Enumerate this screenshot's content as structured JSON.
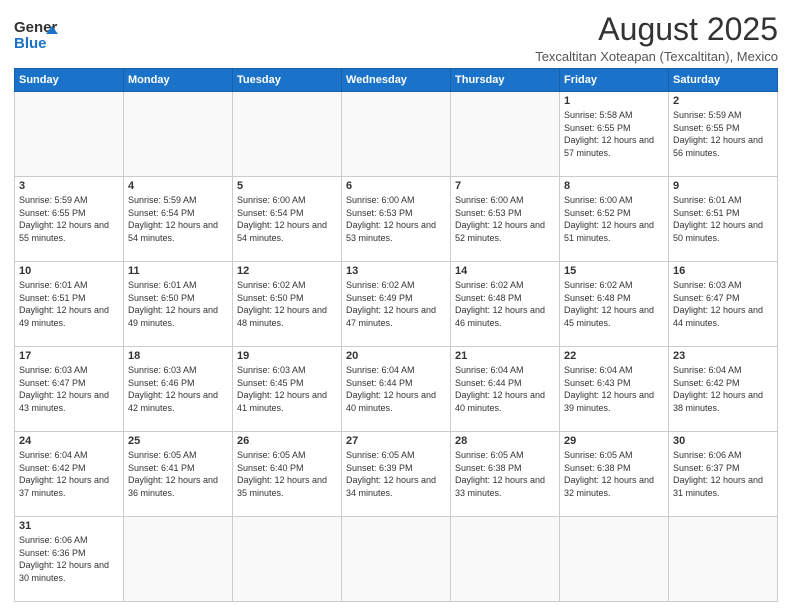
{
  "header": {
    "logo_general": "General",
    "logo_blue": "Blue",
    "main_title": "August 2025",
    "subtitle": "Texcaltitan Xoteapan (Texcaltitan), Mexico"
  },
  "calendar": {
    "weekdays": [
      "Sunday",
      "Monday",
      "Tuesday",
      "Wednesday",
      "Thursday",
      "Friday",
      "Saturday"
    ],
    "weeks": [
      [
        {
          "day": "",
          "info": ""
        },
        {
          "day": "",
          "info": ""
        },
        {
          "day": "",
          "info": ""
        },
        {
          "day": "",
          "info": ""
        },
        {
          "day": "",
          "info": ""
        },
        {
          "day": "1",
          "info": "Sunrise: 5:58 AM\nSunset: 6:55 PM\nDaylight: 12 hours and 57 minutes."
        },
        {
          "day": "2",
          "info": "Sunrise: 5:59 AM\nSunset: 6:55 PM\nDaylight: 12 hours and 56 minutes."
        }
      ],
      [
        {
          "day": "3",
          "info": "Sunrise: 5:59 AM\nSunset: 6:55 PM\nDaylight: 12 hours and 55 minutes."
        },
        {
          "day": "4",
          "info": "Sunrise: 5:59 AM\nSunset: 6:54 PM\nDaylight: 12 hours and 54 minutes."
        },
        {
          "day": "5",
          "info": "Sunrise: 6:00 AM\nSunset: 6:54 PM\nDaylight: 12 hours and 54 minutes."
        },
        {
          "day": "6",
          "info": "Sunrise: 6:00 AM\nSunset: 6:53 PM\nDaylight: 12 hours and 53 minutes."
        },
        {
          "day": "7",
          "info": "Sunrise: 6:00 AM\nSunset: 6:53 PM\nDaylight: 12 hours and 52 minutes."
        },
        {
          "day": "8",
          "info": "Sunrise: 6:00 AM\nSunset: 6:52 PM\nDaylight: 12 hours and 51 minutes."
        },
        {
          "day": "9",
          "info": "Sunrise: 6:01 AM\nSunset: 6:51 PM\nDaylight: 12 hours and 50 minutes."
        }
      ],
      [
        {
          "day": "10",
          "info": "Sunrise: 6:01 AM\nSunset: 6:51 PM\nDaylight: 12 hours and 49 minutes."
        },
        {
          "day": "11",
          "info": "Sunrise: 6:01 AM\nSunset: 6:50 PM\nDaylight: 12 hours and 49 minutes."
        },
        {
          "day": "12",
          "info": "Sunrise: 6:02 AM\nSunset: 6:50 PM\nDaylight: 12 hours and 48 minutes."
        },
        {
          "day": "13",
          "info": "Sunrise: 6:02 AM\nSunset: 6:49 PM\nDaylight: 12 hours and 47 minutes."
        },
        {
          "day": "14",
          "info": "Sunrise: 6:02 AM\nSunset: 6:48 PM\nDaylight: 12 hours and 46 minutes."
        },
        {
          "day": "15",
          "info": "Sunrise: 6:02 AM\nSunset: 6:48 PM\nDaylight: 12 hours and 45 minutes."
        },
        {
          "day": "16",
          "info": "Sunrise: 6:03 AM\nSunset: 6:47 PM\nDaylight: 12 hours and 44 minutes."
        }
      ],
      [
        {
          "day": "17",
          "info": "Sunrise: 6:03 AM\nSunset: 6:47 PM\nDaylight: 12 hours and 43 minutes."
        },
        {
          "day": "18",
          "info": "Sunrise: 6:03 AM\nSunset: 6:46 PM\nDaylight: 12 hours and 42 minutes."
        },
        {
          "day": "19",
          "info": "Sunrise: 6:03 AM\nSunset: 6:45 PM\nDaylight: 12 hours and 41 minutes."
        },
        {
          "day": "20",
          "info": "Sunrise: 6:04 AM\nSunset: 6:44 PM\nDaylight: 12 hours and 40 minutes."
        },
        {
          "day": "21",
          "info": "Sunrise: 6:04 AM\nSunset: 6:44 PM\nDaylight: 12 hours and 40 minutes."
        },
        {
          "day": "22",
          "info": "Sunrise: 6:04 AM\nSunset: 6:43 PM\nDaylight: 12 hours and 39 minutes."
        },
        {
          "day": "23",
          "info": "Sunrise: 6:04 AM\nSunset: 6:42 PM\nDaylight: 12 hours and 38 minutes."
        }
      ],
      [
        {
          "day": "24",
          "info": "Sunrise: 6:04 AM\nSunset: 6:42 PM\nDaylight: 12 hours and 37 minutes."
        },
        {
          "day": "25",
          "info": "Sunrise: 6:05 AM\nSunset: 6:41 PM\nDaylight: 12 hours and 36 minutes."
        },
        {
          "day": "26",
          "info": "Sunrise: 6:05 AM\nSunset: 6:40 PM\nDaylight: 12 hours and 35 minutes."
        },
        {
          "day": "27",
          "info": "Sunrise: 6:05 AM\nSunset: 6:39 PM\nDaylight: 12 hours and 34 minutes."
        },
        {
          "day": "28",
          "info": "Sunrise: 6:05 AM\nSunset: 6:38 PM\nDaylight: 12 hours and 33 minutes."
        },
        {
          "day": "29",
          "info": "Sunrise: 6:05 AM\nSunset: 6:38 PM\nDaylight: 12 hours and 32 minutes."
        },
        {
          "day": "30",
          "info": "Sunrise: 6:06 AM\nSunset: 6:37 PM\nDaylight: 12 hours and 31 minutes."
        }
      ],
      [
        {
          "day": "31",
          "info": "Sunrise: 6:06 AM\nSunset: 6:36 PM\nDaylight: 12 hours and 30 minutes."
        },
        {
          "day": "",
          "info": ""
        },
        {
          "day": "",
          "info": ""
        },
        {
          "day": "",
          "info": ""
        },
        {
          "day": "",
          "info": ""
        },
        {
          "day": "",
          "info": ""
        },
        {
          "day": "",
          "info": ""
        }
      ]
    ]
  }
}
